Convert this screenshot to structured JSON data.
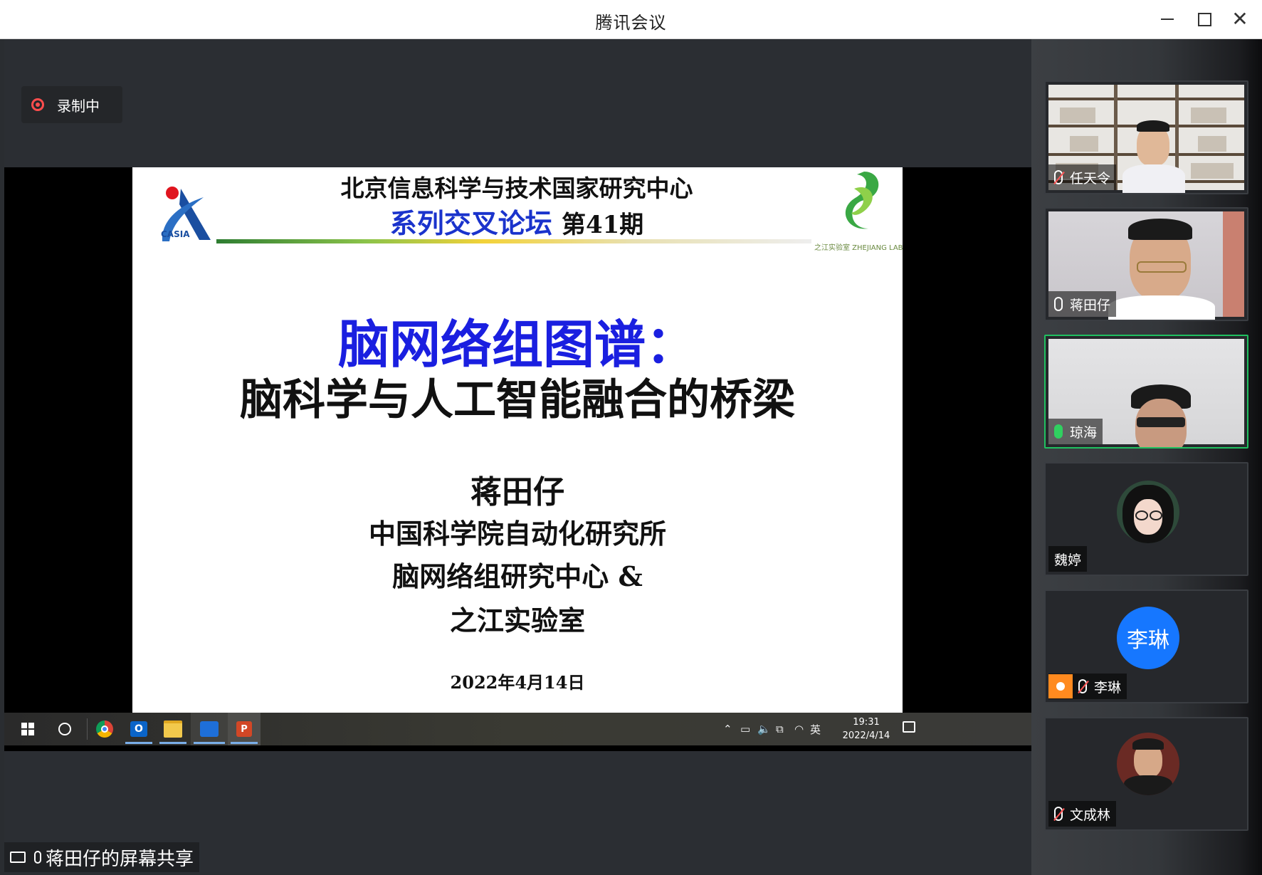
{
  "window": {
    "title": "腾讯会议"
  },
  "recording": {
    "label": "录制中"
  },
  "slide": {
    "header_line1": "北京信息科学与技术国家研究中心",
    "header_series": "系列交叉论坛",
    "header_issue": "第41期",
    "title_line1": "脑网络组图谱：",
    "title_line2": "脑科学与人工智能融合的桥梁",
    "speaker": "蒋田仔",
    "affiliation1": "中国科学院自动化研究所",
    "affiliation2": "脑网络组研究中心 &",
    "affiliation3": "之江实验室",
    "date": "2022年4月14日",
    "logo_left_text": "CASIA",
    "logo_right_text": "之江实验室 ZHEJIANG LAB"
  },
  "taskbar": {
    "ime": "英",
    "time": "19:31",
    "date": "2022/4/14",
    "apps": [
      "chrome-icon",
      "outlook-icon",
      "file-explorer-icon",
      "tencent-meeting-icon",
      "powerpoint-icon"
    ]
  },
  "share_status": {
    "label": "蒋田仔的屏幕共享"
  },
  "participants": [
    {
      "name": "任天令",
      "mic": "muted"
    },
    {
      "name": "蒋田仔",
      "mic": "on"
    },
    {
      "name": "琼海",
      "mic": "speaking"
    },
    {
      "name": "魏婷",
      "mic": "none"
    },
    {
      "name": "李琳",
      "mic": "muted",
      "avatar_text": "李琳"
    },
    {
      "name": "文成林",
      "mic": "muted"
    }
  ],
  "colors": {
    "accent_blue": "#1677ff",
    "speaking_green": "#20c060",
    "record_red": "#ff4d4d",
    "slide_title_blue": "#1a1fe0"
  }
}
